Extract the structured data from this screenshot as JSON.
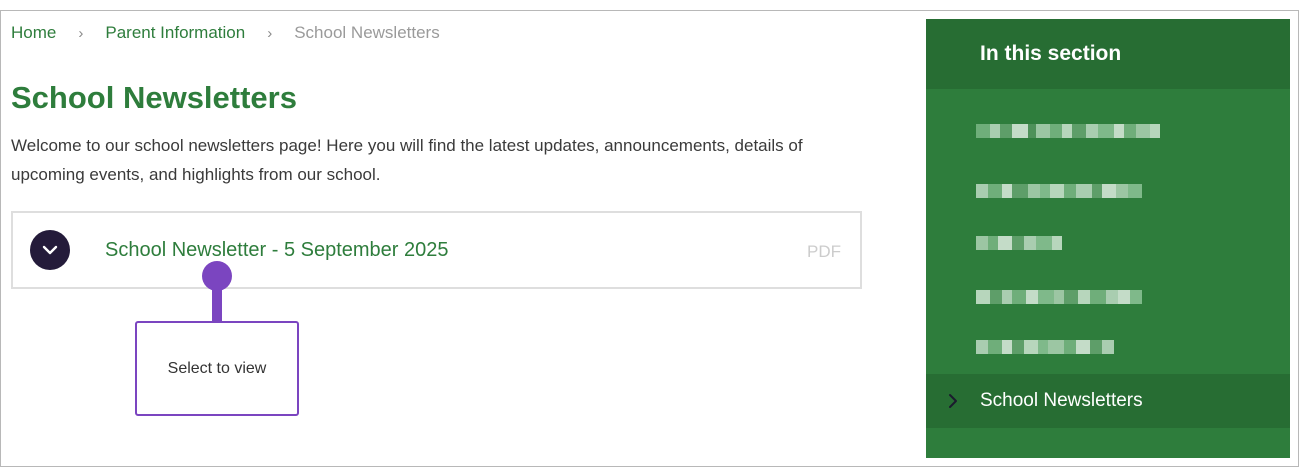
{
  "breadcrumb": {
    "home": "Home",
    "parent": "Parent Information",
    "current": "School Newsletters",
    "separator": "›"
  },
  "page": {
    "title": "School Newsletters",
    "intro": "Welcome to our school newsletters page! Here you will find the latest updates, announcements, details of upcoming events, and highlights from our school."
  },
  "accordion": {
    "title": "School Newsletter - 5 September 2025",
    "file_type": "PDF",
    "toggle_icon": "chevron-down-icon"
  },
  "tooltip": {
    "text": "Select to view"
  },
  "sidebar": {
    "heading": "In this section",
    "active_item": "School Newsletters",
    "active_icon": "chevron-right-icon"
  },
  "colors": {
    "brand_green": "#2e7d3c",
    "sidebar_dark": "#276d33",
    "toggle_dark": "#241b3a",
    "highlight_purple": "#7b45c0"
  }
}
